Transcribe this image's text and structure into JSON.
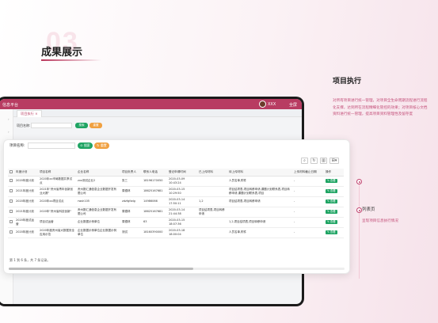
{
  "slide": {
    "bg_number": "03",
    "title": "成果展示"
  },
  "right_panel": {
    "heading": "项目执行",
    "description": "对所有项目进行统一管理，对项目全生命周期流程进行流程化支撑，达到所在流程精细化管控的效果；对项目核心文档资料进行统一管理，提高项目资料管理性及留存度",
    "list_title": "列表页",
    "list_desc": "呈现项目信息执行情况"
  },
  "back_window": {
    "app_title": "信息平台",
    "user_name": "XXX",
    "fullscreen_label": "全屏",
    "tab_label": "项目执行",
    "search_label": "项目名称:",
    "search_button": "搜索",
    "reset_button": "重置"
  },
  "front_window": {
    "search_label": "项目名称:",
    "search_placeholder": "",
    "search_button": "搜索",
    "reset_button": "重置",
    "toolbar": [
      "search-icon",
      "refresh-icon",
      "columns-icon",
      "export-icon"
    ],
    "columns": [
      "",
      "年度计划",
      "项目名称",
      "企业名称",
      "项目负责人",
      "联系人电话",
      "登记申请时间",
      "已上传材料",
      "待上传材料",
      "上传材料截止日期",
      "操作"
    ],
    "rows": [
      [
        "",
        "2020年度计划",
        "2020年xx市局数据共享试点",
        "zxx测试企业2",
        "张三",
        "18196170050",
        "2020-03-09 10:43:24",
        "",
        "人员名单,附件",
        "-",
        "查看"
      ],
      [
        "",
        "2021年度计划",
        "2021年\"贵州省青年创新创业大赛\"",
        "贵州数汇通信息企业数据开发有限公司",
        "周德林",
        "18625167681",
        "2020-03-15 10:29:50",
        "",
        "项目结项表,项目转移申请,课题计划联系表,项目转移申请,课题计划联系表,项目",
        "-",
        "查看"
      ],
      [
        "",
        "2020年度计划",
        "2020年xx项目试点",
        "rwsh105",
        "zdzfgfzdg",
        "14986066",
        "2020-03-14 17:50:11",
        "1,2",
        "项目结项表,项目转移申请",
        "-",
        "查看"
      ],
      [
        "",
        "2021年度计划",
        "2020年\"贵州省科技创新\"",
        "贵州数汇通信息企业数据开发有限公司",
        "周德林",
        "18625167681",
        "2020-03-14 21:44:38",
        "项目结项表,项目转移申请",
        "",
        "-",
        "查看"
      ],
      [
        "",
        "2020年度试运营",
        "项目试运营",
        "企业数据示例单位",
        "周德林",
        "63",
        "2020-03-15 18:07:36",
        "",
        "1,2,项目结项表,项目转移申请",
        "-",
        "查看"
      ],
      [
        "",
        "2020年度计划",
        "2020年度贵州省大数据安全应用示范",
        "企业数据示例单位企业数据示例单位",
        "测试",
        "18160390000",
        "2020-03-18 18:00:04",
        "",
        "人员名单,附件",
        "-",
        "查看"
      ]
    ],
    "pagination": "第 1 到 6 条，共 7 条记录。"
  },
  "colors": {
    "accent": "#b83c62",
    "success": "#1fa463",
    "warning": "#f0a040"
  }
}
